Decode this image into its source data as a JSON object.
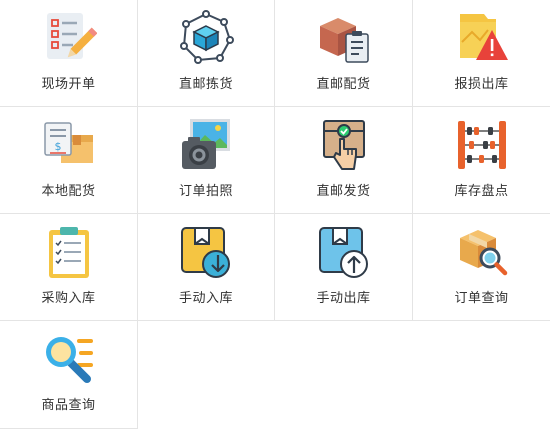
{
  "menu": {
    "items": [
      {
        "label": "现场开单",
        "icon": "checklist-pencil-icon"
      },
      {
        "label": "直邮拣货",
        "icon": "cube-network-icon"
      },
      {
        "label": "直邮配货",
        "icon": "box-clipboard-icon"
      },
      {
        "label": "报损出库",
        "icon": "folder-warning-icon"
      },
      {
        "label": "本地配货",
        "icon": "box-invoice-icon"
      },
      {
        "label": "订单拍照",
        "icon": "camera-photo-icon"
      },
      {
        "label": "直邮发货",
        "icon": "box-hand-tap-icon"
      },
      {
        "label": "库存盘点",
        "icon": "abacus-icon"
      },
      {
        "label": "采购入库",
        "icon": "clipboard-checklist-icon"
      },
      {
        "label": "手动入库",
        "icon": "box-arrow-down-icon"
      },
      {
        "label": "手动出库",
        "icon": "box-arrow-up-icon"
      },
      {
        "label": "订单查询",
        "icon": "box-search-icon"
      },
      {
        "label": "商品查询",
        "icon": "magnifier-list-icon"
      }
    ]
  }
}
